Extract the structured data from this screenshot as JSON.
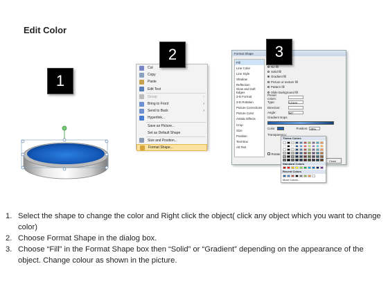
{
  "title": "Edit Color",
  "badges": [
    "1",
    "2",
    "3"
  ],
  "context_menu": {
    "items": [
      {
        "label": "Cut",
        "icon": "scissors-icon",
        "color": "#7a86c8",
        "state": "normal",
        "submenu": false
      },
      {
        "label": "Copy",
        "icon": "copy-icon",
        "color": "#8aa0c0",
        "state": "normal",
        "submenu": false
      },
      {
        "label": "Paste",
        "icon": "paste-icon",
        "color": "#c7a24e",
        "state": "normal",
        "submenu": false
      },
      {
        "label": "Edit Text",
        "icon": "edit-text-icon",
        "color": "#5a7fb8",
        "state": "normal",
        "submenu": false
      },
      {
        "label": "Group",
        "icon": "group-icon",
        "color": "#bbbbbb",
        "state": "gray",
        "submenu": true
      },
      {
        "label": "Bring to Front",
        "icon": "bring-front-icon",
        "color": "#6e8fd0",
        "state": "normal",
        "submenu": true
      },
      {
        "label": "Send to Back",
        "icon": "send-back-icon",
        "color": "#6e8fd0",
        "state": "normal",
        "submenu": true
      },
      {
        "label": "Hyperlink...",
        "icon": "hyperlink-icon",
        "color": "#4a7dd0",
        "state": "normal",
        "submenu": false
      },
      {
        "label": "Save as Picture...",
        "icon": "",
        "color": "",
        "state": "normal",
        "submenu": false
      },
      {
        "label": "Set as Default Shape",
        "icon": "",
        "color": "",
        "state": "normal",
        "submenu": false
      },
      {
        "label": "Size and Position...",
        "icon": "size-icon",
        "color": "#8a9ab5",
        "state": "normal",
        "submenu": false
      },
      {
        "label": "Format Shape...",
        "icon": "format-shape-icon",
        "color": "#d6a43a",
        "state": "highlighted",
        "submenu": false
      }
    ]
  },
  "dialog": {
    "title": "Format Shape",
    "nav": [
      "Fill",
      "Line Color",
      "Line Style",
      "Shadow",
      "Reflection",
      "Glow and Soft Edges",
      "3-D Format",
      "3-D Rotation",
      "Picture Corrections",
      "Picture Color",
      "Artistic Effects",
      "Crop",
      "Size",
      "Position",
      "Text Box",
      "Alt Text"
    ],
    "fill_heading": "Fill",
    "options": [
      "No fill",
      "Solid fill",
      "Gradient fill",
      "Picture or texture fill",
      "Pattern fill",
      "Slide background fill"
    ],
    "selected_option": 2,
    "fields": [
      {
        "label": "Preset colors:",
        "value": ""
      },
      {
        "label": "Type:",
        "value": "Linear"
      },
      {
        "label": "Direction:",
        "value": ""
      },
      {
        "label": "Angle:",
        "value": "90°"
      }
    ],
    "gradient_label": "Gradient stops",
    "color_label": "Color",
    "position_label": "Position:",
    "position_value": "49%",
    "transparency_label": "Transparency:",
    "rotate_label": "Rotate with shape",
    "close_label": "Close"
  },
  "color_popup": {
    "theme_label": "Theme Colors",
    "standard_label": "Standard Colors",
    "recent_label": "Recent Colors",
    "more_label": "More Colors...",
    "theme_top": [
      "#ffffff",
      "#000000",
      "#eeece1",
      "#1f497d",
      "#4f81bd",
      "#c0504d",
      "#9bbb59",
      "#8064a2",
      "#4bacc6",
      "#f79646"
    ],
    "standard": [
      "#c00000",
      "#ff0000",
      "#ffc000",
      "#ffff00",
      "#92d050",
      "#00b050",
      "#00b0f0",
      "#0070c0",
      "#002060",
      "#7030a0"
    ],
    "recent": [
      "#1f5fa8",
      "#4f81bd",
      "#c0504d",
      "#000000",
      "#7f7f7f",
      "#9bbb59",
      "#f79646",
      "#ffffff"
    ]
  },
  "instructions": [
    {
      "num": "1.",
      "text": "Select the shape to change the color and Right click the object( click any object which you want to change color)"
    },
    {
      "num": "2.",
      "text": "Choose Format Shape in the dialog box."
    },
    {
      "num": "3.",
      "text": "Choose “Fill” in the Format Shape box then “Solid” or “Gradient” depending on the appearance of the object. Change colour as shown in the picture."
    }
  ]
}
